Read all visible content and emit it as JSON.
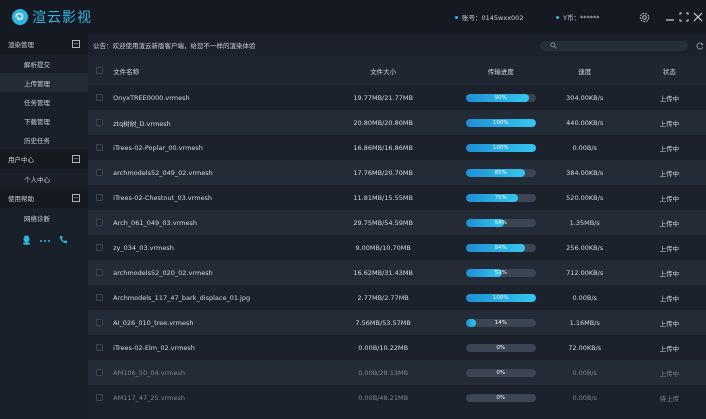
{
  "app": {
    "title": "渲云影视",
    "account_label": "账号：0145wxx002",
    "coins_label": "Y币：******"
  },
  "window_icons": [
    "settings-icon",
    "minimize-icon",
    "maximize-icon",
    "close-icon"
  ],
  "sidebar": {
    "groups": [
      {
        "label": "渲染管理",
        "toggle": "−",
        "items": [
          "解析提交",
          "上传管理",
          "任务管理",
          "下载管理",
          "历史任务"
        ]
      },
      {
        "label": "用户中心",
        "toggle": "−",
        "items": [
          "个人中心"
        ]
      },
      {
        "label": "使用帮助",
        "toggle": "−",
        "items": [
          "网络诊断"
        ]
      }
    ],
    "active_item": "上传管理",
    "contact_icons": [
      "qq-icon",
      "more-icon",
      "phone-icon"
    ]
  },
  "notice": "公告：欢迎使用渲云新版客户端，给您不一样的渲染体验",
  "search": {
    "placeholder": ""
  },
  "table": {
    "columns": [
      "文件名称",
      "文件大小",
      "传输进度",
      "速度",
      "状态"
    ],
    "rows": [
      {
        "name": "OnyxTREE0000.vrmesh",
        "size": "19.77MB/21.77MB",
        "progress": 90,
        "progress_label": "90%",
        "speed": "304.00KB/s",
        "status": "上传中"
      },
      {
        "name": "ztq树树_D.vrmesh",
        "size": "20.80MB/20.80MB",
        "progress": 100,
        "progress_label": "100%",
        "speed": "440.00KB/s",
        "status": "上传中"
      },
      {
        "name": "iTrees-02-Poplar_00.vrmesh",
        "size": "16.86MB/16.86MB",
        "progress": 100,
        "progress_label": "100%",
        "speed": "0.00B/s",
        "status": "上传中"
      },
      {
        "name": "archmodels52_049_02.vrmesh",
        "size": "17.76MB/20.70MB",
        "progress": 85,
        "progress_label": "85%",
        "speed": "384.00KB/s",
        "status": "上传中"
      },
      {
        "name": "iTrees-02-Chestnut_03.vrmesh",
        "size": "11.81MB/15.55MB",
        "progress": 75,
        "progress_label": "75%",
        "speed": "520.00KB/s",
        "status": "上传中"
      },
      {
        "name": "Arch_061_049_03.vrmesh",
        "size": "29.75MB/54.59MB",
        "progress": 54,
        "progress_label": "54%",
        "speed": "1.35MB/s",
        "status": "上传中"
      },
      {
        "name": "zy_034_03.vrmesh",
        "size": "9.00MB/10.70MB",
        "progress": 84,
        "progress_label": "84%",
        "speed": "256.00KB/s",
        "status": "上传中"
      },
      {
        "name": "archmodels52_020_02.vrmesh",
        "size": "16.62MB/31.43MB",
        "progress": 52,
        "progress_label": "52%",
        "speed": "712.00KB/s",
        "status": "上传中"
      },
      {
        "name": "Archmodels_117_47_bark_displace_01.jpg",
        "size": "2.77MB/2.77MB",
        "progress": 100,
        "progress_label": "100%",
        "speed": "0.00B/s",
        "status": "上传中"
      },
      {
        "name": "AI_026_010_tree.vrmesh",
        "size": "7.56MB/53.57MB",
        "progress": 14,
        "progress_label": "14%",
        "speed": "1.16MB/s",
        "status": "上传中"
      },
      {
        "name": "iTrees-02-Elm_02.vrmesh",
        "size": "0.00B/10.22MB",
        "progress": 0,
        "progress_label": "0%",
        "speed": "72.00KB/s",
        "status": "上传中"
      },
      {
        "name": "AM106_50_04.vrmesh",
        "size": "0.00B/28.13MB",
        "progress": 0,
        "progress_label": "0%",
        "speed": "0.00B/s",
        "status": "上传中"
      },
      {
        "name": "AM117_47_25.vrmesh",
        "size": "0.00B/48.21MB",
        "progress": 0,
        "progress_label": "0%",
        "speed": "0.00B/s",
        "status": "待上传"
      }
    ]
  },
  "colors": {
    "accent": "#2fb7e3",
    "background": "#1c222c",
    "titlebar": "#151a22"
  }
}
